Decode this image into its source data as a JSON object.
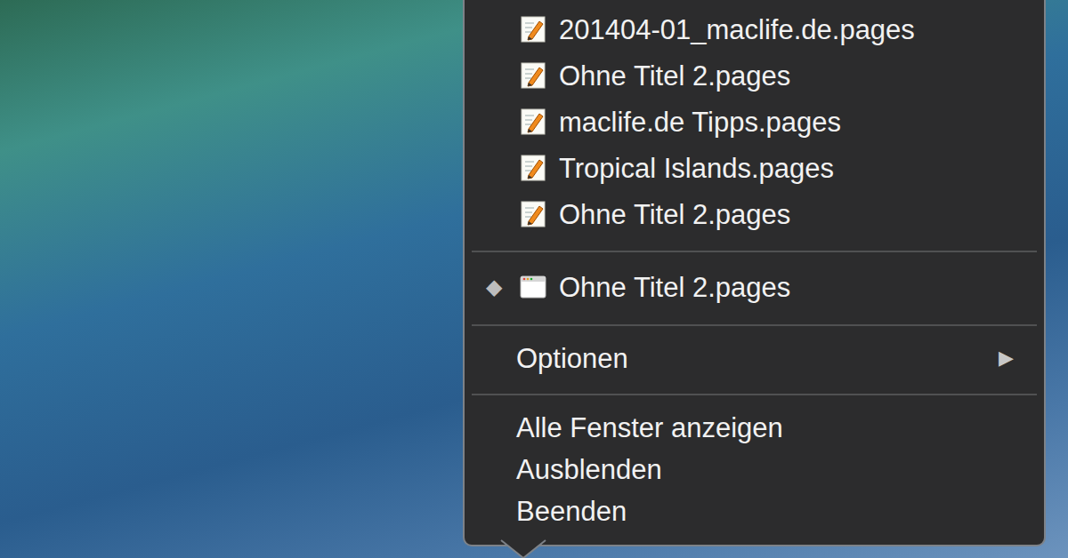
{
  "dock_menu": {
    "documents": [
      {
        "label": "201404-01_maclife.de.pages"
      },
      {
        "label": "Ohne Titel 2.pages"
      },
      {
        "label": "maclife.de Tipps.pages"
      },
      {
        "label": "Tropical Islands.pages"
      },
      {
        "label": "Ohne Titel 2.pages"
      }
    ],
    "windows": [
      {
        "label": "Ohne Titel 2.pages",
        "mark": "◆",
        "minimized": true
      }
    ],
    "options": {
      "label": "Optionen",
      "arrow": "▶"
    },
    "actions": [
      "Alle Fenster anzeigen",
      "Ausblenden",
      "Beenden"
    ]
  }
}
